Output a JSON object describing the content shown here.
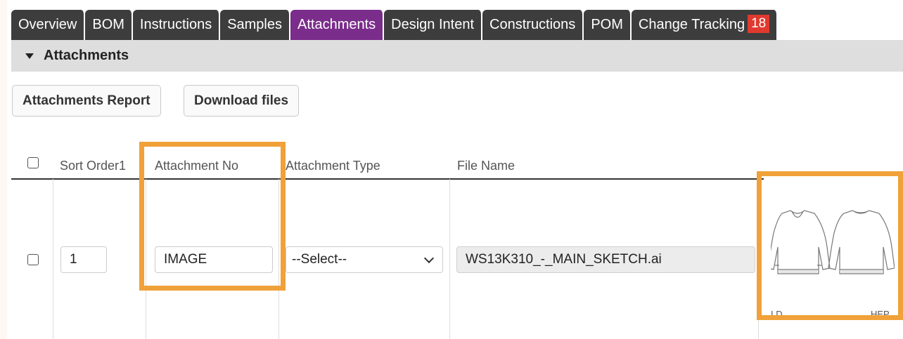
{
  "tabs": [
    {
      "label": "Overview",
      "active": false
    },
    {
      "label": "BOM",
      "active": false
    },
    {
      "label": "Instructions",
      "active": false
    },
    {
      "label": "Samples",
      "active": false
    },
    {
      "label": "Attachments",
      "active": true
    },
    {
      "label": "Design Intent",
      "active": false
    },
    {
      "label": "Constructions",
      "active": false
    },
    {
      "label": "POM",
      "active": false
    },
    {
      "label": "Change Tracking",
      "active": false,
      "badge": "18"
    }
  ],
  "section": {
    "title": "Attachments",
    "expanded": true
  },
  "buttons": {
    "report": "Attachments Report",
    "download": "Download files"
  },
  "table": {
    "columns": [
      "Sort Order1",
      "Attachment No",
      "Attachment Type",
      "File Name"
    ],
    "rows": [
      {
        "sort_order": "1",
        "attachment_no": "IMAGE",
        "attachment_type": "--Select--",
        "file_name": "WS13K310_-_MAIN_SKETCH.ai",
        "thumbnail_captions": [
          "I  D...",
          "HEP"
        ]
      }
    ]
  },
  "colors": {
    "tab_bg": "#3d3d3d",
    "tab_active": "#7b2d8b",
    "badge": "#e03a2f",
    "highlight": "#f0a139"
  }
}
